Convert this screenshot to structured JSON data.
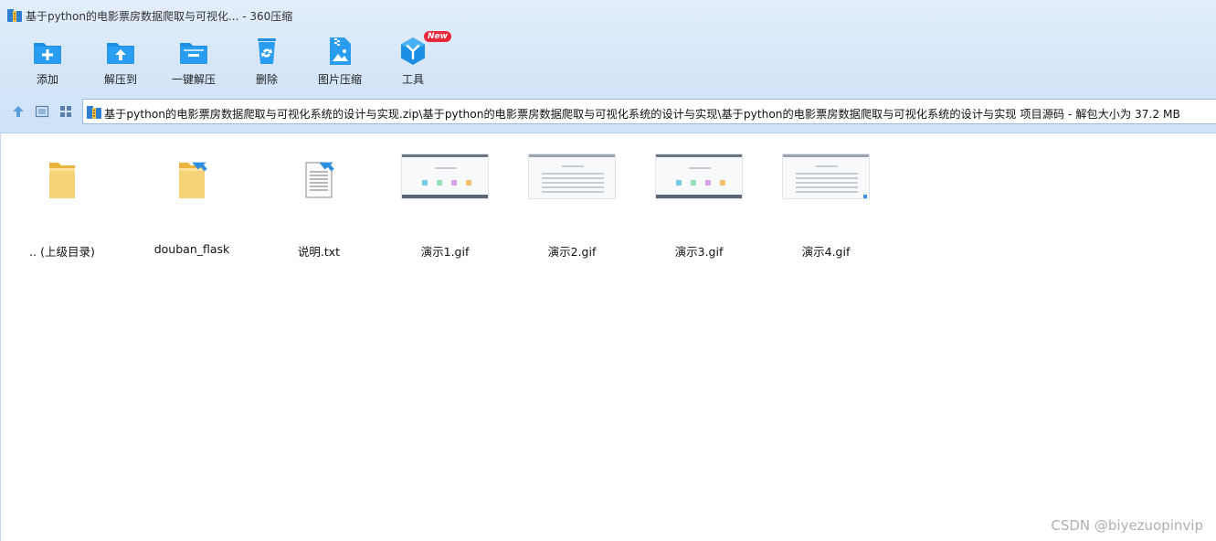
{
  "window": {
    "title": "基于python的电影票房数据爬取与可视化... - 360压缩"
  },
  "toolbar": {
    "buttons": [
      {
        "label": "添加",
        "icon": "add-folder-icon"
      },
      {
        "label": "解压到",
        "icon": "extract-to-icon"
      },
      {
        "label": "一键解压",
        "icon": "one-click-extract-icon"
      },
      {
        "label": "删除",
        "icon": "recycle-bin-icon"
      },
      {
        "label": "图片压缩",
        "icon": "image-compress-icon"
      },
      {
        "label": "工具",
        "icon": "tools-icon",
        "badge": "New"
      }
    ]
  },
  "address": {
    "path": "基于python的电影票房数据爬取与可视化系统的设计与实现.zip\\基于python的电影票房数据爬取与可视化系统的设计与实现\\基于python的电影票房数据爬取与可视化系统的设计与实现 项目源码 - 解包大小为 37.2 MB"
  },
  "files": [
    {
      "name": ".. (上级目录)",
      "type": "parent-folder"
    },
    {
      "name": "douban_flask",
      "type": "folder"
    },
    {
      "name": "说明.txt",
      "type": "text"
    },
    {
      "name": "演示1.gif",
      "type": "gif"
    },
    {
      "name": "演示2.gif",
      "type": "gif"
    },
    {
      "name": "演示3.gif",
      "type": "gif"
    },
    {
      "name": "演示4.gif",
      "type": "gif"
    }
  ],
  "watermark": "CSDN @biyezuopinvip",
  "colors": {
    "accent": "#1c8ee6",
    "chrome": "#d4e5f8",
    "badge": "#e8283a",
    "folder": "#f5c85a"
  }
}
